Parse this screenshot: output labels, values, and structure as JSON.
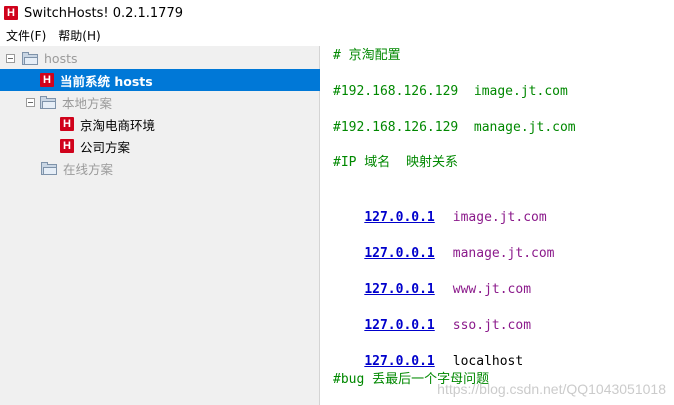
{
  "window": {
    "title": "SwitchHosts! 0.2.1.1779",
    "app_icon_letter": "H"
  },
  "menu": [
    {
      "label": "文件(F)"
    },
    {
      "label": "帮助(H)"
    }
  ],
  "sidebar": {
    "root": {
      "label": "hosts"
    },
    "current": {
      "label": "当前系统 hosts",
      "icon_letter": "H"
    },
    "local_group": {
      "label": "本地方案"
    },
    "local_items": [
      {
        "label": "京淘电商环境",
        "icon_letter": "H"
      },
      {
        "label": "公司方案",
        "icon_letter": "H"
      }
    ],
    "online_group": {
      "label": "在线方案"
    }
  },
  "editor": {
    "comments": [
      "# 京淘配置",
      "#192.168.126.129  image.jt.com",
      "#192.168.126.129  manage.jt.com",
      "#IP 域名  映射关系"
    ],
    "entries": [
      {
        "ip": "127.0.0.1",
        "host": "image.jt.com"
      },
      {
        "ip": "127.0.0.1",
        "host": "manage.jt.com"
      },
      {
        "ip": "127.0.0.1",
        "host": "www.jt.com"
      },
      {
        "ip": "127.0.0.1",
        "host": "sso.jt.com"
      },
      {
        "ip": "127.0.0.1",
        "host": "localhost"
      }
    ],
    "footer_comment": "#bug 丢最后一个字母问题"
  },
  "watermark": "https://blog.csdn.net/QQ1043051018",
  "colors": {
    "selection": "#0078d7",
    "comment": "#008800",
    "ip": "#0000cc",
    "host": "#8b1a8b",
    "h_icon": "#d0021b"
  }
}
